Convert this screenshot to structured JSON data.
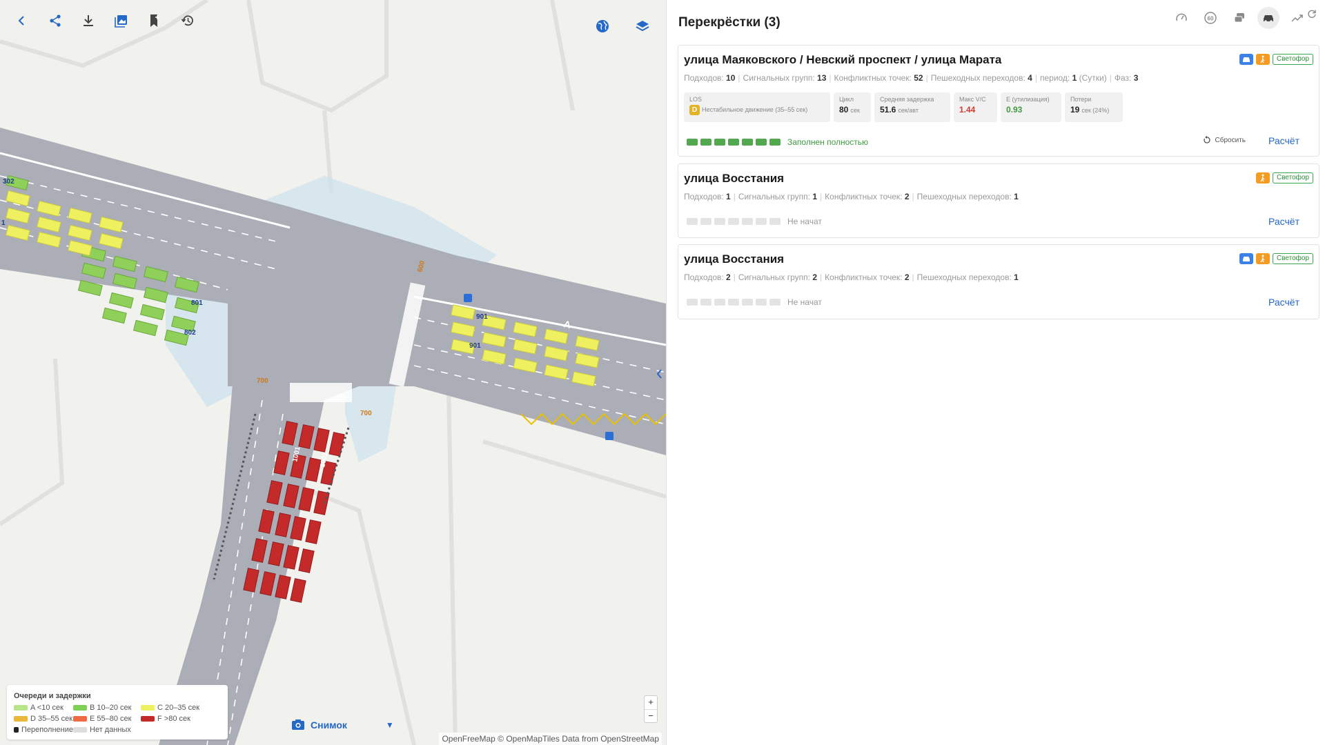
{
  "map": {
    "toolbar": {
      "back_icon": "chevron-left-icon",
      "share_icon": "share-icon",
      "download_icon": "download-icon",
      "gallery_icon": "image-gallery-icon",
      "bookmark_icon": "bookmark-add-icon",
      "history_icon": "history-icon",
      "globe_icon": "globe-icon",
      "layers_icon": "layers-icon"
    },
    "labels": {
      "l302": "302",
      "l1": "1",
      "l801": "801",
      "l802": "802",
      "l901a": "901",
      "l901b": "901",
      "l600": "600",
      "l700a": "700",
      "l700b": "700",
      "l1001": "1001",
      "l1002": "1002",
      "lA": "A"
    },
    "legend": {
      "title": "Очереди и задержки",
      "items": [
        {
          "label": "A <10 сек",
          "color": "#b9e58a"
        },
        {
          "label": "B 10–20 сек",
          "color": "#7fcf55"
        },
        {
          "label": "C 20–35 сек",
          "color": "#eef060"
        },
        {
          "label": "D 35–55 сек",
          "color": "#e9b73c"
        },
        {
          "label": "E 55–80 сек",
          "color": "#ee6a45"
        },
        {
          "label": "F >80 сек",
          "color": "#c52a2a"
        },
        {
          "label": "Переполнение",
          "color": "#222222"
        },
        {
          "label": "Нет данных",
          "color": "#dddddd"
        }
      ]
    },
    "snapshot_label": "Снимок",
    "zoom_in": "+",
    "zoom_out": "−",
    "attribution": {
      "part1": "OpenFreeMap",
      "part2": " © ",
      "part3": "OpenMapTiles",
      "part4": " Data from ",
      "part5": "OpenStreetMap"
    }
  },
  "panel": {
    "title": "Перекрёстки (3)",
    "header_icons": [
      "speedometer-icon",
      "speed-limit-60-icon",
      "traffic-cars-icon",
      "car-icon",
      "trend-icon",
      "refresh-icon"
    ],
    "cards": [
      {
        "title": "улица Маяковского / Невский проспект / улица Марата",
        "badge_text": "Светофор",
        "meta": {
          "approaches_label": "Подходов:",
          "approaches": "10",
          "groups_label": "Сигнальных групп:",
          "groups": "13",
          "conflicts_label": "Конфликтных точек:",
          "conflicts": "52",
          "peds_label": "Пешеходных переходов:",
          "peds": "4",
          "period_label": "период:",
          "period": "1",
          "period_unit": "(Сутки)",
          "phases_label": "Фаз:",
          "phases": "3"
        },
        "metrics": {
          "los_label": "LOS",
          "los_grade": "D",
          "los_desc": "Нестабильное движение (35–55 сек)",
          "cycle_label": "Цикл",
          "cycle_val": "80",
          "cycle_unit": "сек",
          "delay_label": "Средняя задержка",
          "delay_val": "51.6",
          "delay_unit": "сек/авт",
          "vc_label": "Макс V/C",
          "vc_val": "1.44",
          "vc_color": "#d23b2f",
          "e_label": "E (утилизация)",
          "e_val": "0.93",
          "e_color": "#3f9a3f",
          "loss_label": "Потери",
          "loss_val": "19",
          "loss_unit": "сек (24%)"
        },
        "progress_filled": 7,
        "progress_text": "Заполнен полностью",
        "reset_label": "Сбросить",
        "calc_label": "Расчёт"
      },
      {
        "title": "улица Восстания",
        "badge_text": "Светофор",
        "meta": {
          "approaches_label": "Подходов:",
          "approaches": "1",
          "groups_label": "Сигнальных групп:",
          "groups": "1",
          "conflicts_label": "Конфликтных точек:",
          "conflicts": "2",
          "peds_label": "Пешеходных переходов:",
          "peds": "1"
        },
        "progress_filled": 0,
        "progress_text": "Не начат",
        "calc_label": "Расчёт"
      },
      {
        "title": "улица Восстания",
        "badge_text": "Светофор",
        "meta": {
          "approaches_label": "Подходов:",
          "approaches": "2",
          "groups_label": "Сигнальных групп:",
          "groups": "2",
          "conflicts_label": "Конфликтных точек:",
          "conflicts": "2",
          "peds_label": "Пешеходных переходов:",
          "peds": "1"
        },
        "progress_filled": 0,
        "progress_text": "Не начат",
        "calc_label": "Расчёт"
      }
    ]
  }
}
